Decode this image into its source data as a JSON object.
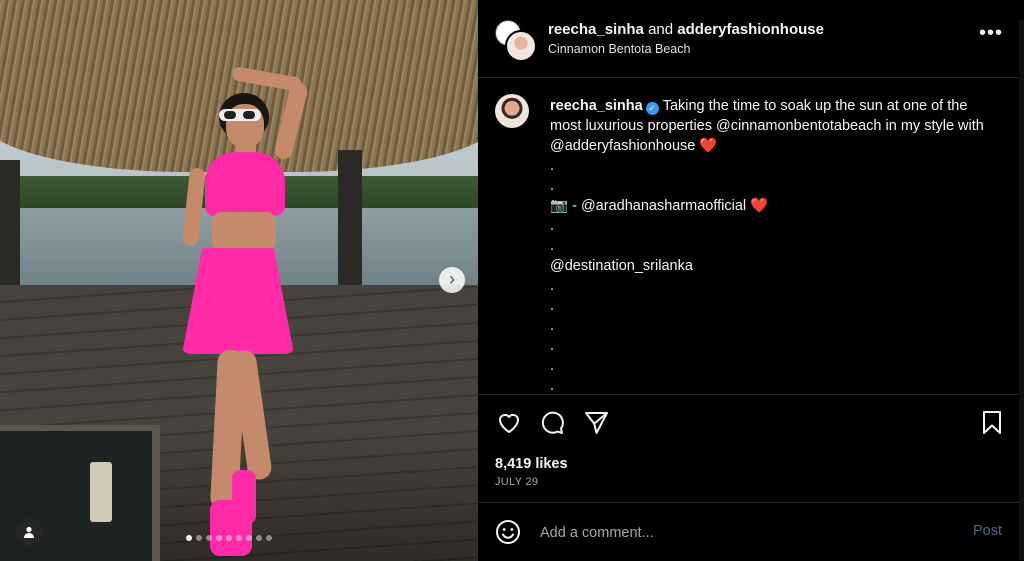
{
  "post": {
    "carousel": {
      "slide_count": 9,
      "active_index": 0,
      "next_icon": "chevron-right-icon",
      "tag_icon": "user-tag-icon"
    },
    "header": {
      "user1": "reecha_sinha",
      "and_text": "and",
      "user2": "adderyfashionhouse",
      "location": "Cinnamon Bentota Beach",
      "more_label": "•••"
    },
    "caption": {
      "username": "reecha_sinha",
      "verified_icon": "verified-badge-icon",
      "line1": "Taking the time to soak up the sun at one of the most luxurious properties @cinnamonbentotabeach in my style with @adderyfashionhouse",
      "heart1": "❤️",
      "dots_a": [
        ".",
        "."
      ],
      "credit_camera": "📷",
      "credit": "- @aradhanasharmaofficial",
      "heart2": "❤️",
      "dots_b": [
        ".",
        "."
      ],
      "tag": "@destination_srilanka",
      "dots_c": [
        ".",
        ".",
        ".",
        ".",
        ".",
        "."
      ]
    },
    "actions": {
      "like_icon": "heart-icon",
      "comment_icon": "comment-icon",
      "share_icon": "share-icon",
      "save_icon": "bookmark-icon"
    },
    "likes": "8,419 likes",
    "date": "JULY 29",
    "comment": {
      "emoji_icon": "emoji-icon",
      "placeholder": "Add a comment...",
      "post_label": "Post"
    },
    "colors": {
      "background": "#000000",
      "divider": "#262626",
      "verified": "#3897f0",
      "heart": "#ed2a3d",
      "post_button": "#4a6a8a",
      "outfit": "#ff2aa8"
    }
  }
}
